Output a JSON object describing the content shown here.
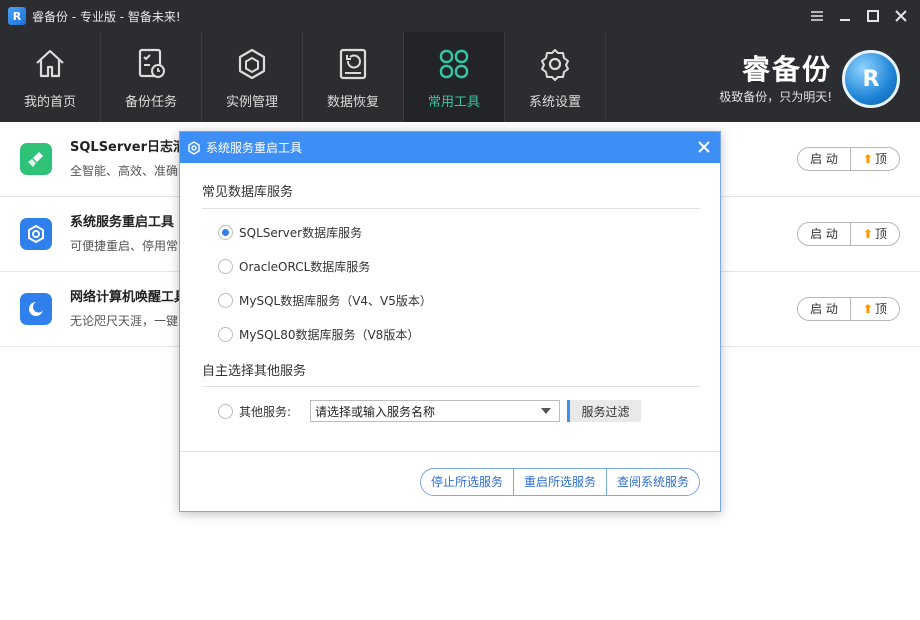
{
  "window": {
    "title": "睿备份 - 专业版 - 智备未来!",
    "logo_glyph": "R"
  },
  "nav": {
    "items": [
      {
        "label": "我的首页",
        "icon": "home-icon"
      },
      {
        "label": "备份任务",
        "icon": "task-icon"
      },
      {
        "label": "实例管理",
        "icon": "instance-icon"
      },
      {
        "label": "数据恢复",
        "icon": "restore-icon"
      },
      {
        "label": "常用工具",
        "icon": "tools-icon",
        "active": true
      },
      {
        "label": "系统设置",
        "icon": "gear-icon"
      }
    ]
  },
  "brand": {
    "name": "睿备份",
    "slogan": "极致备份，只为明天!",
    "logo_glyph": "R"
  },
  "tools": [
    {
      "title": "SQLServer日志清",
      "desc": "全智能、高效、准确",
      "start": "启 动",
      "top": "顶",
      "icon_color": "#2fc37a"
    },
    {
      "title": "系统服务重启工具",
      "desc": "可便捷重启、停用常",
      "start": "启 动",
      "top": "顶",
      "icon_color": "#2f80ed"
    },
    {
      "title": "网络计算机唤醒工具",
      "desc": "无论咫尺天涯，一键",
      "start": "启 动",
      "top": "顶",
      "icon_color": "#2f80ed"
    }
  ],
  "dialog": {
    "title": "系统服务重启工具",
    "section_common": "常见数据库服务",
    "options": [
      {
        "label": "SQLServer数据库服务",
        "checked": true
      },
      {
        "label": "OracleORCL数据库服务",
        "checked": false
      },
      {
        "label": "MySQL数据库服务（V4、V5版本）",
        "checked": false
      },
      {
        "label": "MySQL80数据库服务（V8版本）",
        "checked": false
      }
    ],
    "section_custom": "自主选择其他服务",
    "other_label": "其他服务:",
    "combo_value": "请选择或输入服务名称",
    "filter_label": "服务过滤",
    "actions": {
      "stop": "停止所选服务",
      "restart": "重启所选服务",
      "browse": "查阅系统服务"
    }
  },
  "colors": {
    "nav_bg": "#2b2d31",
    "nav_active_text": "#34c7a5",
    "dialog_header": "#3d8ff5",
    "accent_blue": "#2f80ed",
    "top_arrow": "#ff9800"
  }
}
